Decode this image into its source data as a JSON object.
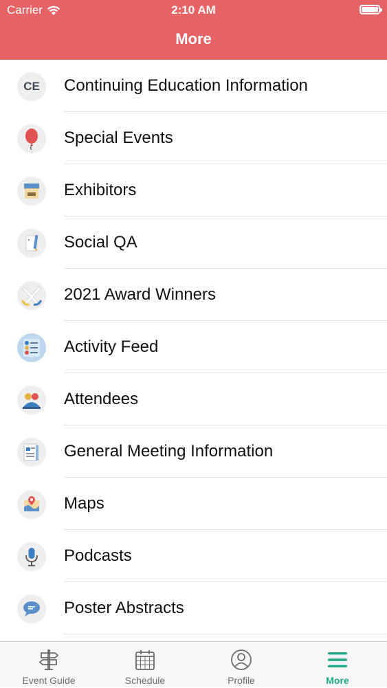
{
  "status_bar": {
    "carrier": "Carrier",
    "time": "2:10 AM"
  },
  "header": {
    "title": "More",
    "color": "#e56366"
  },
  "menu": {
    "items": [
      {
        "label": "Continuing Education Information",
        "icon": "ce-badge-icon",
        "icon_text": "CE"
      },
      {
        "label": "Special Events",
        "icon": "balloon-icon"
      },
      {
        "label": "Exhibitors",
        "icon": "storefront-icon"
      },
      {
        "label": "Social QA",
        "icon": "pencil-note-icon"
      },
      {
        "label": "2021 Award Winners",
        "icon": "ribbon-icon"
      },
      {
        "label": "Activity Feed",
        "icon": "feed-list-icon"
      },
      {
        "label": "Attendees",
        "icon": "people-icon"
      },
      {
        "label": "General Meeting Information",
        "icon": "document-icon"
      },
      {
        "label": "Maps",
        "icon": "map-pin-icon"
      },
      {
        "label": "Podcasts",
        "icon": "microphone-icon"
      },
      {
        "label": "Poster Abstracts",
        "icon": "speech-bubble-icon"
      }
    ]
  },
  "tab_bar": {
    "active_color": "#1ea98a",
    "tabs": [
      {
        "label": "Event Guide",
        "icon": "signpost-icon",
        "active": false
      },
      {
        "label": "Schedule",
        "icon": "calendar-icon",
        "active": false
      },
      {
        "label": "Profile",
        "icon": "user-circle-icon",
        "active": false
      },
      {
        "label": "More",
        "icon": "hamburger-menu-icon",
        "active": true
      }
    ]
  }
}
